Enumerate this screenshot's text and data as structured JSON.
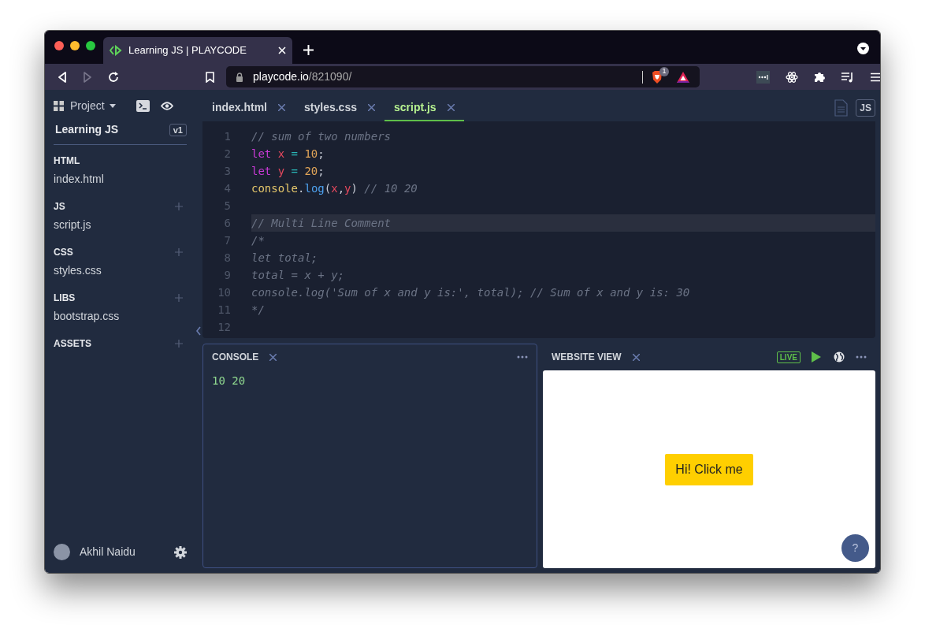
{
  "browser": {
    "tab_title": "Learning JS | PLAYCODE",
    "url_host": "playcode.io",
    "url_path": "/821090/",
    "shields_count": "1"
  },
  "sidebar": {
    "project_menu": "Project",
    "project_name": "Learning JS",
    "version": "v1",
    "sections": [
      {
        "title": "HTML",
        "addable": false,
        "files": [
          "index.html"
        ]
      },
      {
        "title": "JS",
        "addable": true,
        "files": [
          "script.js"
        ]
      },
      {
        "title": "CSS",
        "addable": true,
        "files": [
          "styles.css"
        ]
      },
      {
        "title": "LIBS",
        "addable": true,
        "files": [
          "bootstrap.css"
        ]
      },
      {
        "title": "ASSETS",
        "addable": true
      }
    ],
    "user": "Akhil Naidu"
  },
  "editor": {
    "tabs": [
      {
        "label": "index.html",
        "selected": false
      },
      {
        "label": "styles.css",
        "selected": false
      },
      {
        "label": "script.js",
        "selected": true
      }
    ],
    "badge": "JS",
    "lines": [
      {
        "number": "1",
        "highlighted": false,
        "tokens": [
          {
            "kind": "comment",
            "text": "// sum of two numbers"
          }
        ]
      },
      {
        "number": "2",
        "highlighted": false,
        "tokens": [
          {
            "kind": "keyword",
            "text": "let"
          },
          {
            "kind": "variable",
            "text": " x"
          },
          {
            "kind": "operator",
            "text": " ="
          },
          {
            "kind": "number",
            "text": " 10"
          },
          {
            "kind": "plain",
            "text": ";"
          }
        ]
      },
      {
        "number": "3",
        "highlighted": false,
        "tokens": [
          {
            "kind": "keyword",
            "text": "let"
          },
          {
            "kind": "variable",
            "text": " y"
          },
          {
            "kind": "operator",
            "text": " ="
          },
          {
            "kind": "number",
            "text": " 20"
          },
          {
            "kind": "plain",
            "text": ";"
          }
        ]
      },
      {
        "number": "4",
        "highlighted": false,
        "tokens": [
          {
            "kind": "object",
            "text": "console"
          },
          {
            "kind": "plain",
            "text": "."
          },
          {
            "kind": "function",
            "text": "log"
          },
          {
            "kind": "plain",
            "text": "("
          },
          {
            "kind": "variable",
            "text": "x"
          },
          {
            "kind": "plain",
            "text": ","
          },
          {
            "kind": "variable",
            "text": "y"
          },
          {
            "kind": "plain",
            "text": ") "
          },
          {
            "kind": "comment",
            "text": "// 10 20"
          }
        ]
      },
      {
        "number": "5",
        "highlighted": false
      },
      {
        "number": "6",
        "highlighted": true,
        "tokens": [
          {
            "kind": "comment",
            "text": "// Multi Line Comment"
          }
        ]
      },
      {
        "number": "7",
        "highlighted": false,
        "tokens": [
          {
            "kind": "comment",
            "text": "/*"
          }
        ]
      },
      {
        "number": "8",
        "highlighted": false,
        "tokens": [
          {
            "kind": "comment",
            "text": "let total;"
          }
        ]
      },
      {
        "number": "9",
        "highlighted": false,
        "tokens": [
          {
            "kind": "comment",
            "text": "total = x + y;"
          }
        ]
      },
      {
        "number": "10",
        "highlighted": false,
        "tokens": [
          {
            "kind": "comment",
            "text": "console.log('Sum of x and y is:', total); // Sum of x and y is: 30"
          }
        ]
      },
      {
        "number": "11",
        "highlighted": false,
        "tokens": [
          {
            "kind": "comment",
            "text": "*/"
          }
        ]
      },
      {
        "number": "12",
        "highlighted": false
      }
    ]
  },
  "console": {
    "title": "CONSOLE",
    "output": [
      "10 20"
    ]
  },
  "website_view": {
    "title": "WEBSITE VIEW",
    "live": "LIVE",
    "page_button": "Hi! Click me",
    "help": "?"
  }
}
